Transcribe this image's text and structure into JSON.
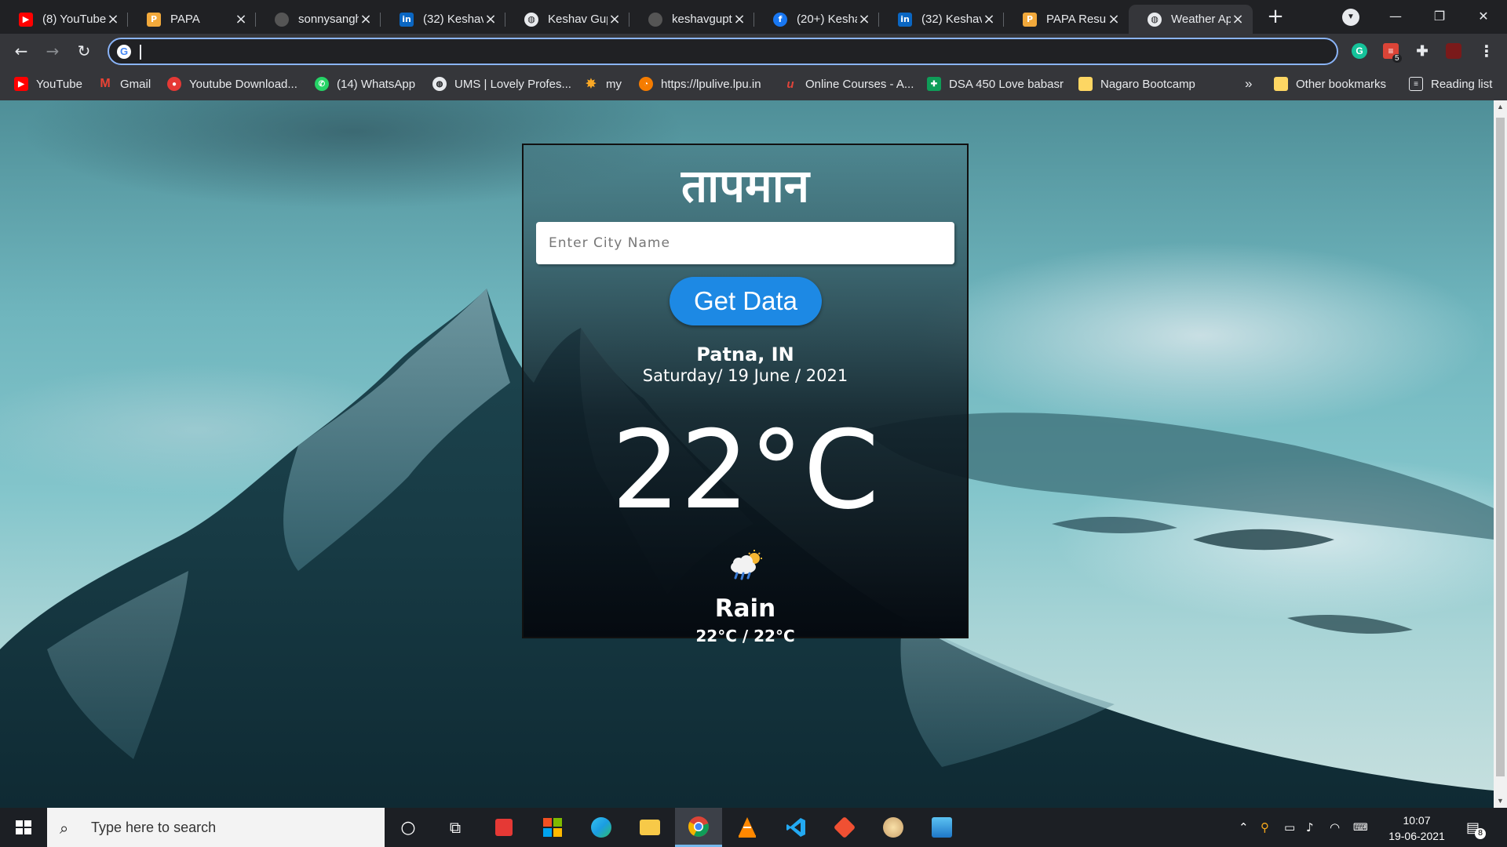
{
  "browser": {
    "tabs": [
      {
        "title": "(8) YouTube",
        "icon": "youtube-icon",
        "color": "#ff0000"
      },
      {
        "title": "PAPA",
        "icon": "papa-icon",
        "color": "#f2a93b"
      },
      {
        "title": "sonnysangh",
        "icon": "github-icon",
        "color": "#555555"
      },
      {
        "title": "(32) Keshav",
        "icon": "linkedin-icon",
        "color": "#0a66c2"
      },
      {
        "title": "Keshav Gup",
        "icon": "globe-icon",
        "color": "#9aa0a6"
      },
      {
        "title": "keshavgupt",
        "icon": "github-icon",
        "color": "#555555"
      },
      {
        "title": "(20+) Kesha",
        "icon": "facebook-icon",
        "color": "#1877f2"
      },
      {
        "title": "(32) Keshav",
        "icon": "linkedin-icon",
        "color": "#0a66c2"
      },
      {
        "title": "PAPA Resun",
        "icon": "papa-icon",
        "color": "#f2a93b"
      },
      {
        "title": "Weather Ap",
        "icon": "globe-icon",
        "color": "#9aa0a6",
        "active": true
      }
    ],
    "address": {
      "value": ""
    },
    "bookmarks": [
      {
        "label": "YouTube",
        "icon": "youtube-icon",
        "color": "#ff0000"
      },
      {
        "label": "Gmail",
        "icon": "gmail-icon",
        "color": "#ea4335"
      },
      {
        "label": "Youtube Download...",
        "icon": "download-icon",
        "color": "#e53935"
      },
      {
        "label": "(14) WhatsApp",
        "icon": "whatsapp-icon",
        "color": "#25d366"
      },
      {
        "label": "UMS | Lovely Profes...",
        "icon": "globe-icon",
        "color": "#9aa0a6"
      },
      {
        "label": "my",
        "icon": "sun-icon",
        "color": "#f9a825"
      },
      {
        "label": "https://lpulive.lpu.in",
        "icon": "lpu-icon",
        "color": "#f57c00"
      },
      {
        "label": "Online Courses - A...",
        "icon": "udemy-icon",
        "color": "#a435f0"
      },
      {
        "label": "DSA 450 Love babasr",
        "icon": "sheets-icon",
        "color": "#0f9d58"
      },
      {
        "label": "Nagaro Bootcamp",
        "icon": "folder-icon",
        "color": "#fdd663"
      }
    ],
    "overflow_label": "»",
    "other_bookmarks": "Other bookmarks",
    "reading_list": "Reading list",
    "extension_badge": "5"
  },
  "weather_app": {
    "heading": "तापमान",
    "city_placeholder": "Enter City Name",
    "button_label": "Get Data",
    "location": "Patna, IN",
    "date": "Saturday/ 19 June / 2021",
    "temperature": "22°C",
    "condition": "Rain",
    "min_max": "22°C / 22°C",
    "condition_icon": "rain-cloud-icon"
  },
  "taskbar": {
    "search_placeholder": "Type here to search",
    "time": "10:07",
    "date": "19-06-2021",
    "notification_count": "8"
  },
  "colors": {
    "accent_button": "#1d89e4",
    "omnibox_focus": "#8ab4f8"
  }
}
